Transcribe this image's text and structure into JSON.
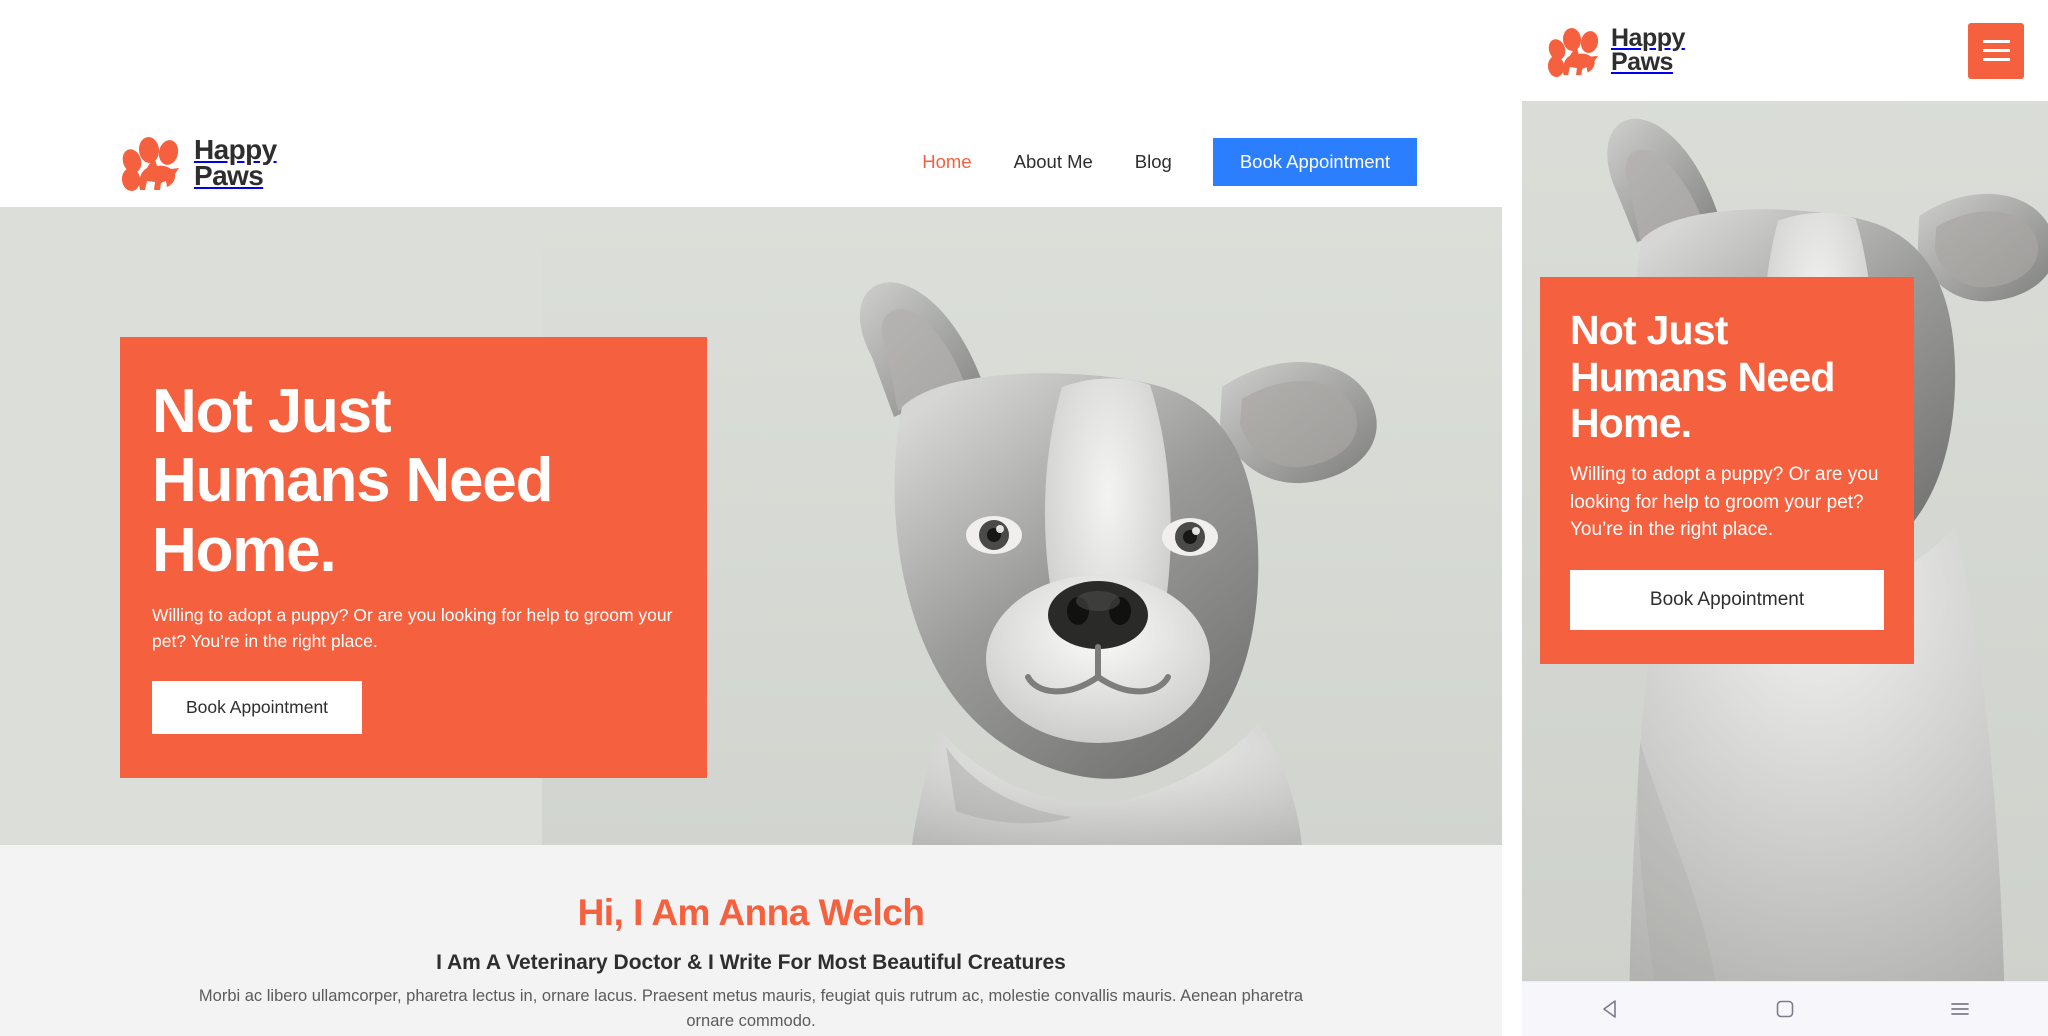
{
  "brand": {
    "name_line1": "Happy",
    "name_line2": "Paws",
    "accent_color": "#F5603F",
    "cta_color": "#2B7FFF",
    "hero_bg_color": "#dcdfd9",
    "about_bg_color": "#f3f3f3"
  },
  "desktop": {
    "nav": {
      "links": [
        {
          "label": "Home",
          "active": true
        },
        {
          "label": "About Me",
          "active": false
        },
        {
          "label": "Blog",
          "active": false
        }
      ],
      "cta_label": "Book Appointment"
    },
    "hero": {
      "heading_line1": "Not Just",
      "heading_line2": "Humans Need",
      "heading_line3": "Home.",
      "paragraph": "Willing to adopt a puppy? Or are you looking for help to groom your pet? You’re in the right place.",
      "button_label": "Book Appointment",
      "image_alt": "greyscale-pitbull-dog-portrait"
    },
    "about": {
      "heading": "Hi, I Am Anna Welch",
      "subheading": "I Am A Veterinary Doctor & I Write For Most Beautiful Creatures",
      "paragraph": "Morbi ac libero ullamcorper, pharetra lectus in, ornare lacus. Praesent metus mauris, feugiat quis rutrum ac, molestie convallis mauris. Aenean pharetra ornare commodo."
    }
  },
  "mobile": {
    "menu_button_icon": "hamburger-icon",
    "hero": {
      "heading_line1": "Not Just",
      "heading_line2": "Humans Need",
      "heading_line3": "Home.",
      "paragraph": "Willing to adopt a puppy? Or are you looking for help to groom your pet? You’re in the right place.",
      "button_label": "Book Appointment"
    },
    "system_nav": {
      "back_icon": "triangle-back-icon",
      "home_icon": "square-home-icon",
      "recents_icon": "hamburger-recents-icon"
    }
  }
}
